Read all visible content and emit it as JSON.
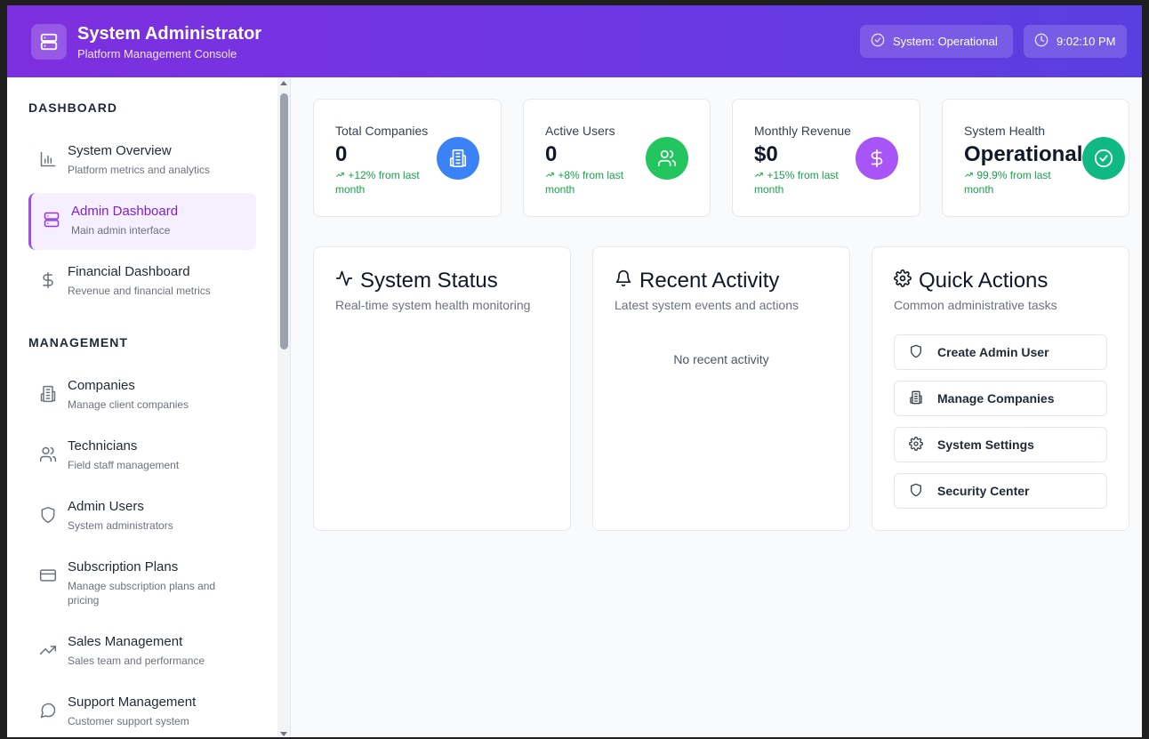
{
  "header": {
    "title": "System Administrator",
    "subtitle": "Platform Management Console",
    "status_label": "System: Operational",
    "time": "9:02:10 PM"
  },
  "sidebar": {
    "sections": [
      {
        "title": "DASHBOARD",
        "items": [
          {
            "label": "System Overview",
            "desc": "Platform metrics and analytics",
            "icon": "bar-chart-icon"
          },
          {
            "label": "Admin Dashboard",
            "desc": "Main admin interface",
            "icon": "server-icon",
            "active": true
          },
          {
            "label": "Financial Dashboard",
            "desc": "Revenue and financial metrics",
            "icon": "dollar-icon"
          }
        ]
      },
      {
        "title": "MANAGEMENT",
        "items": [
          {
            "label": "Companies",
            "desc": "Manage client companies",
            "icon": "building-icon"
          },
          {
            "label": "Technicians",
            "desc": "Field staff management",
            "icon": "users-icon"
          },
          {
            "label": "Admin Users",
            "desc": "System administrators",
            "icon": "shield-icon"
          },
          {
            "label": "Subscription Plans",
            "desc": "Manage subscription plans and pricing",
            "icon": "credit-card-icon"
          },
          {
            "label": "Sales Management",
            "desc": "Sales team and performance",
            "icon": "trending-up-icon"
          },
          {
            "label": "Support Management",
            "desc": "Customer support system",
            "icon": "message-circle-icon"
          }
        ]
      }
    ]
  },
  "stats": [
    {
      "title": "Total Companies",
      "value": "0",
      "trend": "+12% from last month",
      "icon": "building-icon",
      "color": "#3b82f6"
    },
    {
      "title": "Active Users",
      "value": "0",
      "trend": "+8% from last month",
      "icon": "users-icon",
      "color": "#22c55e"
    },
    {
      "title": "Monthly Revenue",
      "value": "$0",
      "trend": "+15% from last month",
      "icon": "dollar-icon",
      "color": "#a855f7"
    },
    {
      "title": "System Health",
      "value": "Operational",
      "trend": "99.9% from last month",
      "icon": "check-circle-icon",
      "color": "#10b981"
    }
  ],
  "panels": {
    "system_status": {
      "title": "System Status",
      "subtitle": "Real-time system health monitoring"
    },
    "recent_activity": {
      "title": "Recent Activity",
      "subtitle": "Latest system events and actions",
      "empty": "No recent activity"
    },
    "quick_actions": {
      "title": "Quick Actions",
      "subtitle": "Common administrative tasks",
      "buttons": [
        {
          "label": "Create Admin User",
          "icon": "shield-icon"
        },
        {
          "label": "Manage Companies",
          "icon": "building-icon"
        },
        {
          "label": "System Settings",
          "icon": "gear-icon"
        },
        {
          "label": "Security Center",
          "icon": "shield-icon"
        }
      ]
    }
  },
  "colors": {
    "accent": "#9333ea",
    "header_start": "#7e2fe0",
    "header_end": "#5a3fe0",
    "trend": "#16a34a"
  }
}
